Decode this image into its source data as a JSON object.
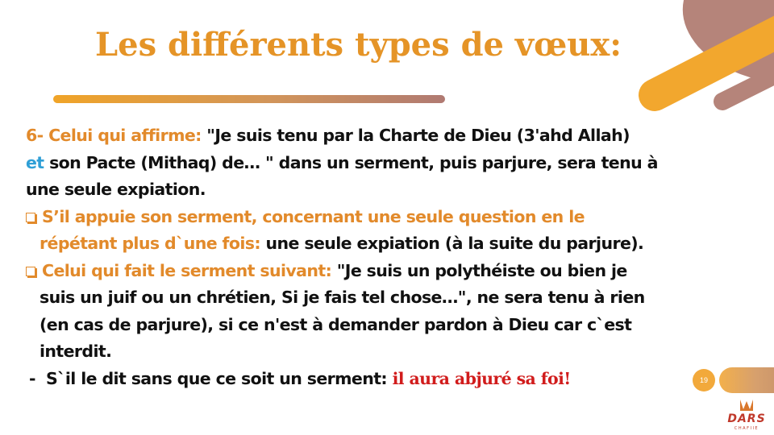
{
  "slide": {
    "title": "Les différents types de vœux:",
    "page_number": "19",
    "logo": {
      "name": "DARS",
      "tagline": "CHAFIIE"
    },
    "colors": {
      "accent_orange": "#e28a2b",
      "accent_blue": "#2f9fd6",
      "accent_red": "#d11c1c",
      "deco_brown": "#b5847a",
      "deco_orange": "#f2a72e"
    }
  },
  "paragraph": {
    "number_label": "6- Celui qui affirme:",
    "quote_part1": "\"Je suis tenu par la Charte de Dieu (3'ahd Allah)",
    "conjunction": "et",
    "quote_part2": "son Pacte (Mithaq) de… \" dans un serment, puis parjure, sera tenu à",
    "conclusion": "une seule expiation."
  },
  "bullets": [
    {
      "lead_line1": "S’il appuie son serment, concernant une seule question en le",
      "lead_line2": "répétant plus d`une fois:",
      "rest_line2": " une seule expiation (à la suite du parjure)."
    },
    {
      "lead_line1": "Celui qui fait le serment suivant:",
      "rest_line1": " \"Je suis un polythéiste ou bien je",
      "line2": "suis un juif ou un chrétien, Si je fais tel chose…\", ne sera tenu à rien",
      "line3": "(en cas de parjure), si ce n'est à demander pardon à Dieu car c`est",
      "line4": "interdit."
    }
  ],
  "dash_item": {
    "dash": "-",
    "text": "S`il le dit sans que ce soit un serment:",
    "emphasis": "il aura abjuré sa foi!"
  }
}
